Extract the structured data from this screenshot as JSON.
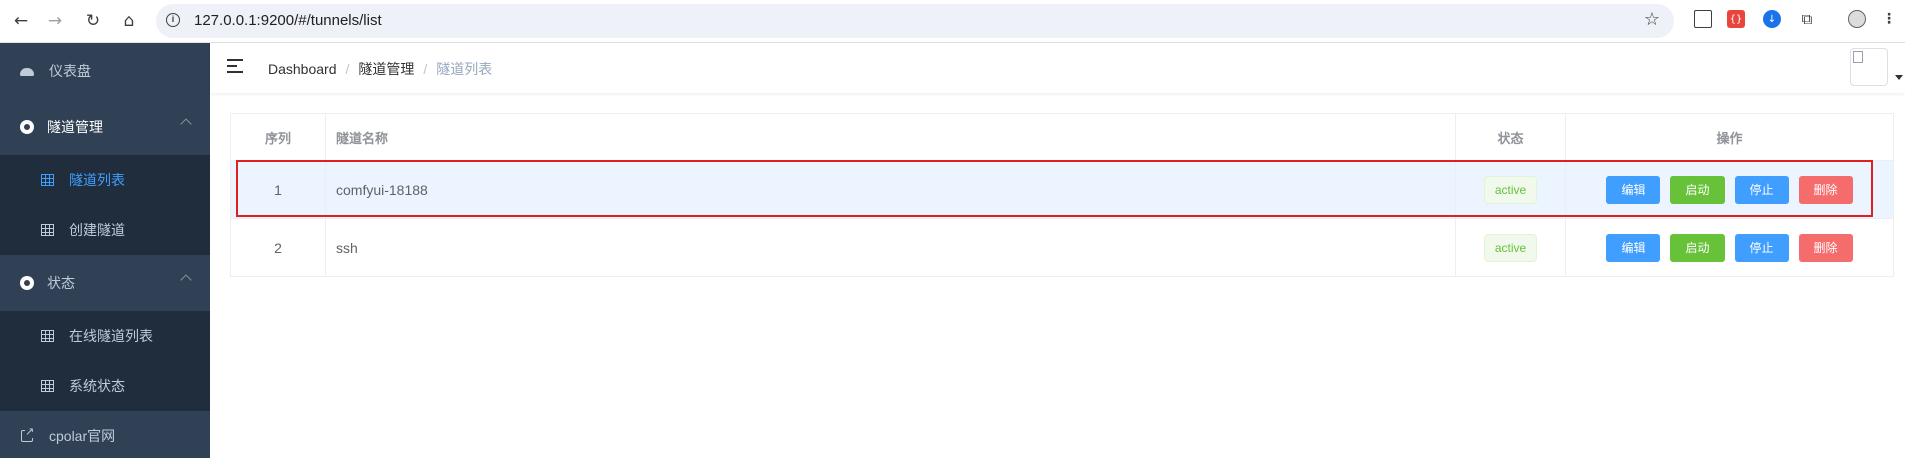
{
  "browser": {
    "url": "127.0.0.1:9200/#/tunnels/list"
  },
  "sidebar": {
    "items": [
      {
        "label": "仪表盘",
        "icon": "dashboard-icon"
      },
      {
        "label": "隧道管理",
        "icon": "circle-icon",
        "expanded": true
      },
      {
        "label": "隧道列表",
        "icon": "table-icon",
        "active": true
      },
      {
        "label": "创建隧道",
        "icon": "table-icon"
      },
      {
        "label": "状态",
        "icon": "circle-icon",
        "expanded": true
      },
      {
        "label": "在线隧道列表",
        "icon": "table-icon"
      },
      {
        "label": "系统状态",
        "icon": "table-icon"
      },
      {
        "label": "cpolar官网",
        "icon": "external-link-icon"
      }
    ]
  },
  "breadcrumb": [
    "Dashboard",
    "隧道管理",
    "隧道列表"
  ],
  "table": {
    "columns": [
      "序列",
      "隧道名称",
      "状态",
      "操作"
    ],
    "rows": [
      {
        "index": "1",
        "name": "comfyui-18188",
        "status": "active"
      },
      {
        "index": "2",
        "name": "ssh",
        "status": "active"
      }
    ],
    "actions": {
      "edit": "编辑",
      "start": "启动",
      "stop": "停止",
      "delete": "删除"
    }
  },
  "colors": {
    "sidebar_bg": "#304156",
    "submenu_bg": "#1f2d3d",
    "accent": "#409eff",
    "success": "#67c23a",
    "danger": "#f56c6c",
    "highlight_border": "#e0201e"
  }
}
